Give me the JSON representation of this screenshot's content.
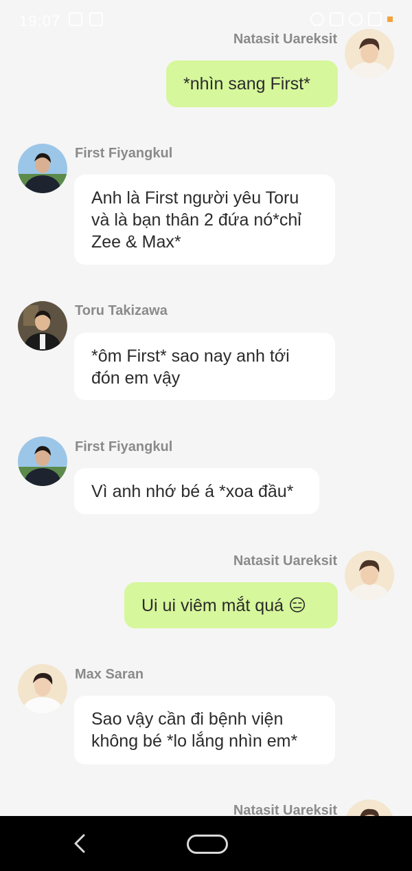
{
  "status_bar": {
    "time": "19:07"
  },
  "messages": [
    {
      "sender": "Natasit  Uareksit",
      "side": "right",
      "text": "*nhìn sang First*"
    },
    {
      "sender": "First Fiyangkul",
      "side": "left",
      "text": "Anh là First người yêu Toru và là bạn thân 2 đứa nó*chỉ Zee & Max*"
    },
    {
      "sender": "Toru Takizawa",
      "side": "left",
      "text": "*ôm First* sao nay anh tới đón em vậy"
    },
    {
      "sender": "First Fiyangkul",
      "side": "left",
      "text": "Vì anh nhớ bé á *xoa đầu*"
    },
    {
      "sender": "Natasit  Uareksit",
      "side": "right",
      "text": "Ui ui viêm mắt quá 😑"
    },
    {
      "sender": "Max Saran",
      "side": "left",
      "text": "Sao vậy cần đi bệnh viện không bé *lo lắng nhìn em*"
    },
    {
      "sender": "Natasit  Uareksit",
      "side": "right",
      "text": ""
    }
  ],
  "colors": {
    "background": "#f5f5f5",
    "bubble_self": "#d6f79b",
    "bubble_other": "#ffffff",
    "name_text": "#8a8a8a"
  },
  "icons": {
    "nav_back": "back-arrow-icon",
    "nav_home": "home-pill-icon"
  }
}
